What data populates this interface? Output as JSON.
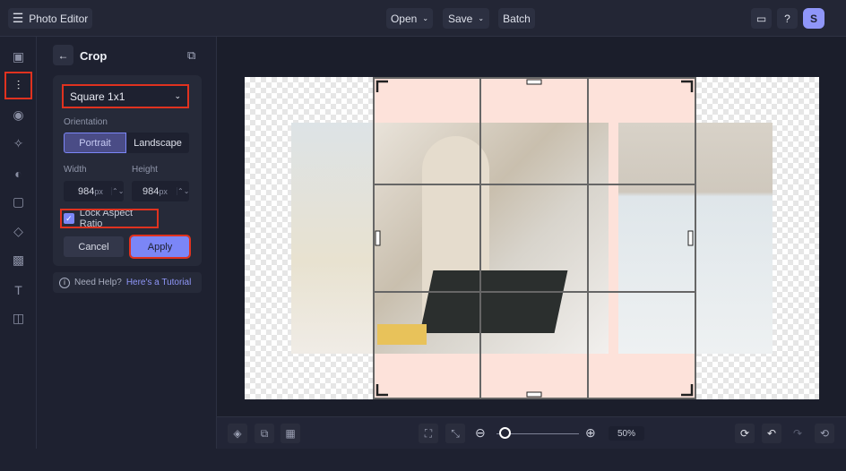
{
  "app": {
    "title": "Photo Editor",
    "menu": [
      "Open",
      "Save",
      "Batch"
    ],
    "avatar": "S"
  },
  "panel": {
    "title": "Crop",
    "preset": "Square 1x1",
    "orientation_label": "Orientation",
    "orientation": [
      "Portrait",
      "Landscape"
    ],
    "selected_orientation": "Portrait",
    "width_label": "Width",
    "height_label": "Height",
    "width": "984",
    "height": "984",
    "unit": "px",
    "lock_label": "Lock Aspect Ratio",
    "lock_checked": true,
    "cancel": "Cancel",
    "apply": "Apply",
    "help_text": "Need Help?",
    "help_link": "Here's a Tutorial"
  },
  "zoom": {
    "value": "50%",
    "level": 0.05
  },
  "colors": {
    "accent": "#7b86f7",
    "highlight": "#e0321f"
  }
}
